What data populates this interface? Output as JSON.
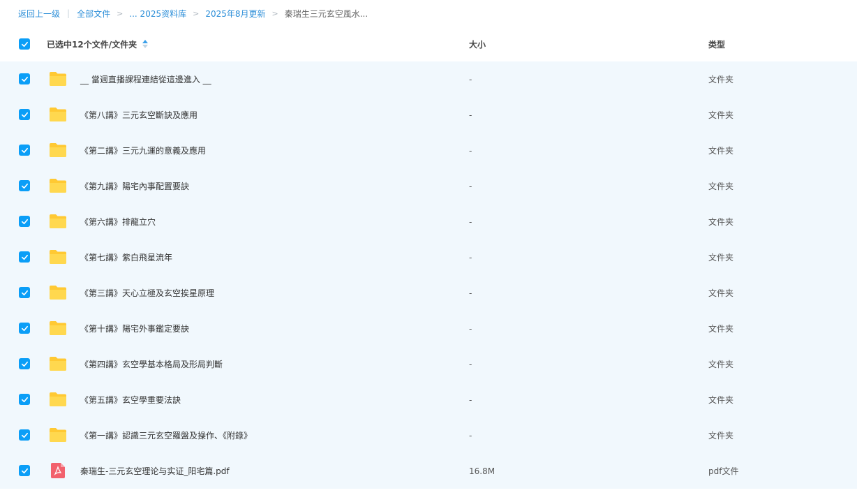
{
  "breadcrumb": {
    "back": "返回上一级",
    "separator_bar": "|",
    "items": [
      "全部文件",
      "... 2025资料库",
      "2025年8月更新"
    ],
    "chevron": ">",
    "current": "秦瑞生三元玄空風水..."
  },
  "header": {
    "selection_label": "已选中12个文件/文件夹",
    "size_label": "大小",
    "type_label": "类型"
  },
  "colors": {
    "accent": "#0b9ef7",
    "link": "#2b8ed8",
    "row_bg": "#f1f8fd",
    "folder": "#ffc933",
    "pdf": "#f2616d"
  },
  "files": [
    {
      "name": "__ 當週直播課程連結從這邊進入 __",
      "size": "-",
      "type": "文件夹",
      "icon": "folder-icon"
    },
    {
      "name": "《第八講》三元玄空斷訣及應用",
      "size": "-",
      "type": "文件夹",
      "icon": "folder-icon"
    },
    {
      "name": "《第二講》三元九運的意義及應用",
      "size": "-",
      "type": "文件夹",
      "icon": "folder-icon"
    },
    {
      "name": "《第九講》陽宅內事配置要訣",
      "size": "-",
      "type": "文件夹",
      "icon": "folder-icon"
    },
    {
      "name": "《第六講》排龍立穴",
      "size": "-",
      "type": "文件夹",
      "icon": "folder-icon"
    },
    {
      "name": "《第七講》紫白飛星流年",
      "size": "-",
      "type": "文件夹",
      "icon": "folder-icon"
    },
    {
      "name": "《第三講》天心立極及玄空挨星原理",
      "size": "-",
      "type": "文件夹",
      "icon": "folder-icon"
    },
    {
      "name": "《第十講》陽宅外事鑑定要訣",
      "size": "-",
      "type": "文件夹",
      "icon": "folder-icon"
    },
    {
      "name": "《第四講》玄空學基本格局及形局判斷",
      "size": "-",
      "type": "文件夹",
      "icon": "folder-icon"
    },
    {
      "name": "《第五講》玄空學重要法訣",
      "size": "-",
      "type": "文件夹",
      "icon": "folder-icon"
    },
    {
      "name": "《第一講》認識三元玄空羅盤及操作、《附錄》",
      "size": "-",
      "type": "文件夹",
      "icon": "folder-icon"
    },
    {
      "name": "秦瑞生-三元玄空理论与实证_阳宅篇.pdf",
      "size": "16.8M",
      "type": "pdf文件",
      "icon": "pdf-icon"
    }
  ]
}
